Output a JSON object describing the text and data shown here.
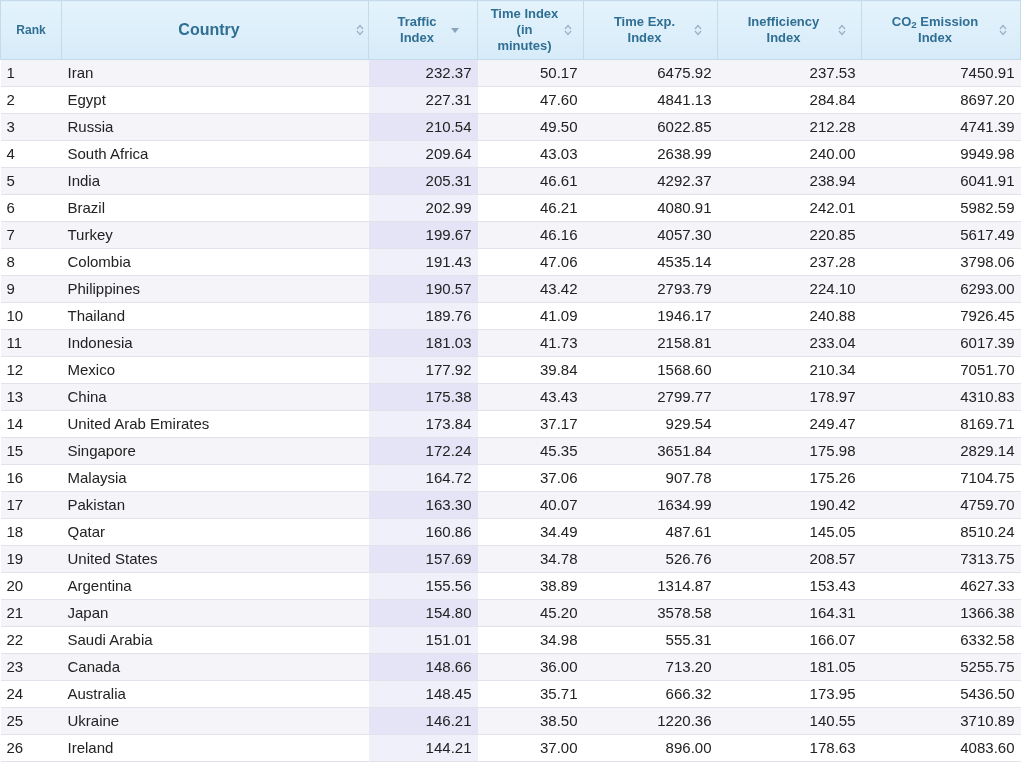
{
  "table": {
    "columns": [
      {
        "label": "Rank",
        "sortable": false,
        "sorted_descending": false
      },
      {
        "label": "Country",
        "sortable": true,
        "sorted_descending": false
      },
      {
        "label": "Traffic Index",
        "sortable": true,
        "sorted_descending": true
      },
      {
        "label": "Time Index (in minutes)",
        "sortable": true,
        "sorted_descending": false
      },
      {
        "label": "Time Exp. Index",
        "sortable": true,
        "sorted_descending": false
      },
      {
        "label": "Inefficiency Index",
        "sortable": true,
        "sorted_descending": false
      },
      {
        "label": "CO$_{2}$ Emission Index",
        "sortable": true,
        "sorted_descending": false
      }
    ],
    "rows": [
      [
        "1",
        "Iran",
        "232.37",
        "50.17",
        "6475.92",
        "237.53",
        "7450.91"
      ],
      [
        "2",
        "Egypt",
        "227.31",
        "47.60",
        "4841.13",
        "284.84",
        "8697.20"
      ],
      [
        "3",
        "Russia",
        "210.54",
        "49.50",
        "6022.85",
        "212.28",
        "4741.39"
      ],
      [
        "4",
        "South Africa",
        "209.64",
        "43.03",
        "2638.99",
        "240.00",
        "9949.98"
      ],
      [
        "5",
        "India",
        "205.31",
        "46.61",
        "4292.37",
        "238.94",
        "6041.91"
      ],
      [
        "6",
        "Brazil",
        "202.99",
        "46.21",
        "4080.91",
        "242.01",
        "5982.59"
      ],
      [
        "7",
        "Turkey",
        "199.67",
        "46.16",
        "4057.30",
        "220.85",
        "5617.49"
      ],
      [
        "8",
        "Colombia",
        "191.43",
        "47.06",
        "4535.14",
        "237.28",
        "3798.06"
      ],
      [
        "9",
        "Philippines",
        "190.57",
        "43.42",
        "2793.79",
        "224.10",
        "6293.00"
      ],
      [
        "10",
        "Thailand",
        "189.76",
        "41.09",
        "1946.17",
        "240.88",
        "7926.45"
      ],
      [
        "11",
        "Indonesia",
        "181.03",
        "41.73",
        "2158.81",
        "233.04",
        "6017.39"
      ],
      [
        "12",
        "Mexico",
        "177.92",
        "39.84",
        "1568.60",
        "210.34",
        "7051.70"
      ],
      [
        "13",
        "China",
        "175.38",
        "43.43",
        "2799.77",
        "178.97",
        "4310.83"
      ],
      [
        "14",
        "United Arab Emirates",
        "173.84",
        "37.17",
        "929.54",
        "249.47",
        "8169.71"
      ],
      [
        "15",
        "Singapore",
        "172.24",
        "45.35",
        "3651.84",
        "175.98",
        "2829.14"
      ],
      [
        "16",
        "Malaysia",
        "164.72",
        "37.06",
        "907.78",
        "175.26",
        "7104.75"
      ],
      [
        "17",
        "Pakistan",
        "163.30",
        "40.07",
        "1634.99",
        "190.42",
        "4759.70"
      ],
      [
        "18",
        "Qatar",
        "160.86",
        "34.49",
        "487.61",
        "145.05",
        "8510.24"
      ],
      [
        "19",
        "United States",
        "157.69",
        "34.78",
        "526.76",
        "208.57",
        "7313.75"
      ],
      [
        "20",
        "Argentina",
        "155.56",
        "38.89",
        "1314.87",
        "153.43",
        "4627.33"
      ],
      [
        "21",
        "Japan",
        "154.80",
        "45.20",
        "3578.58",
        "164.31",
        "1366.38"
      ],
      [
        "22",
        "Saudi Arabia",
        "151.01",
        "34.98",
        "555.31",
        "166.07",
        "6332.58"
      ],
      [
        "23",
        "Canada",
        "148.66",
        "36.00",
        "713.20",
        "181.05",
        "5255.75"
      ],
      [
        "24",
        "Australia",
        "148.45",
        "35.71",
        "666.32",
        "173.95",
        "5436.50"
      ],
      [
        "25",
        "Ukraine",
        "146.21",
        "38.50",
        "1220.36",
        "140.55",
        "3710.89"
      ],
      [
        "26",
        "Ireland",
        "144.21",
        "37.00",
        "896.00",
        "178.63",
        "4083.60"
      ]
    ]
  }
}
